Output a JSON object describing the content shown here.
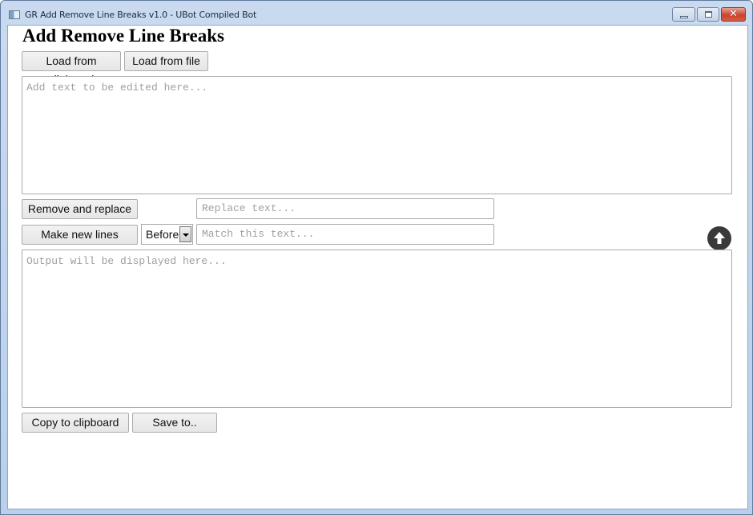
{
  "window": {
    "title": "GR Add Remove Line Breaks v1.0 - UBot Compiled Bot",
    "controls": {
      "minimize": "minimize",
      "maximize": "maximize",
      "close": "✕"
    }
  },
  "app": {
    "heading": "Add Remove Line Breaks",
    "load_clipboard_label": "Load from clipboard",
    "load_file_label": "Load from file",
    "input_placeholder": "Add text to be edited here...",
    "input_value": "",
    "remove_replace_label": "Remove and replace",
    "replace_placeholder": "Replace text...",
    "replace_value": "",
    "make_new_lines_label": "Make new lines",
    "position_select": {
      "selected": "Before"
    },
    "match_placeholder": "Match this text...",
    "match_value": "",
    "scroll_top_icon": "arrow-up-circle-icon",
    "output_placeholder": "Output will be displayed here...",
    "output_value": "",
    "copy_clipboard_label": "Copy to clipboard",
    "save_label": "Save to.."
  }
}
